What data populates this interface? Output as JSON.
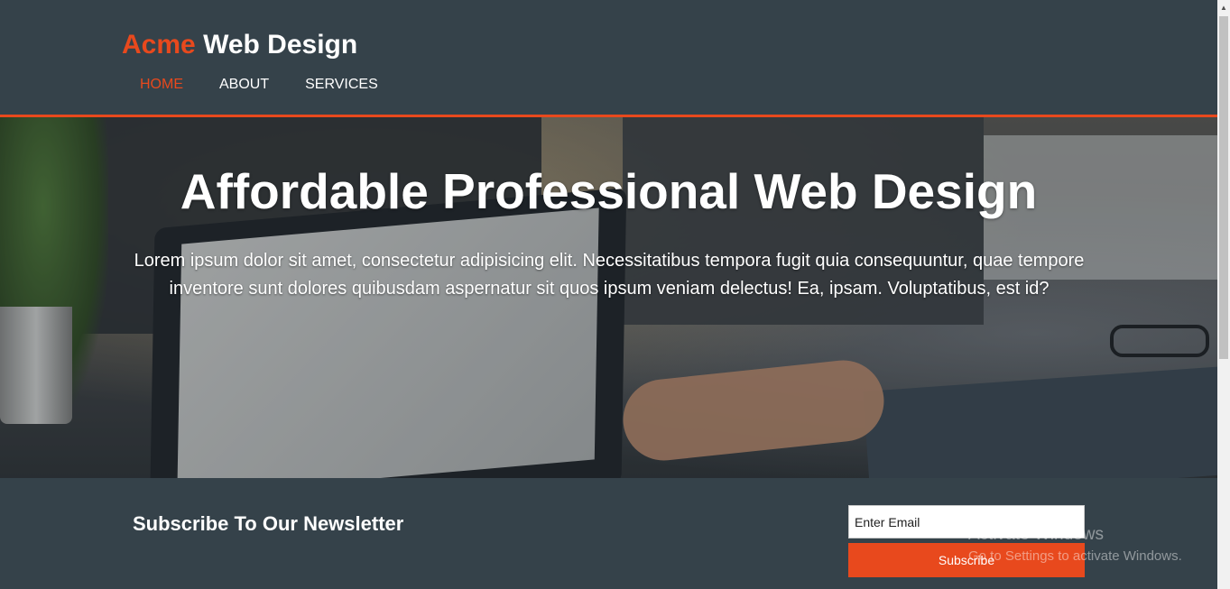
{
  "header": {
    "brand_accent": "Acme",
    "brand_rest": "Web Design",
    "nav": [
      {
        "label": "HOME",
        "active": true
      },
      {
        "label": "ABOUT",
        "active": false
      },
      {
        "label": "SERVICES",
        "active": false
      }
    ]
  },
  "showcase": {
    "title": "Affordable Professional Web Design",
    "text": "Lorem ipsum dolor sit amet, consectetur adipisicing elit. Necessitatibus tempora fugit quia consequuntur, quae tempore inventore sunt dolores quibusdam aspernatur sit quos ipsum veniam delectus! Ea, ipsam. Voluptatibus, est id?"
  },
  "newsletter": {
    "title": "Subscribe To Our Newsletter",
    "email_placeholder": "Enter Email",
    "button_label": "Subscribe"
  },
  "watermark": {
    "title": "Activate Windows",
    "subtitle": "Go to Settings to activate Windows."
  },
  "icons": {
    "scroll_up": "scroll-up-arrow-icon"
  },
  "colors": {
    "primary_dark": "#35424a",
    "accent": "#e8491d",
    "text_light": "#ffffff"
  }
}
